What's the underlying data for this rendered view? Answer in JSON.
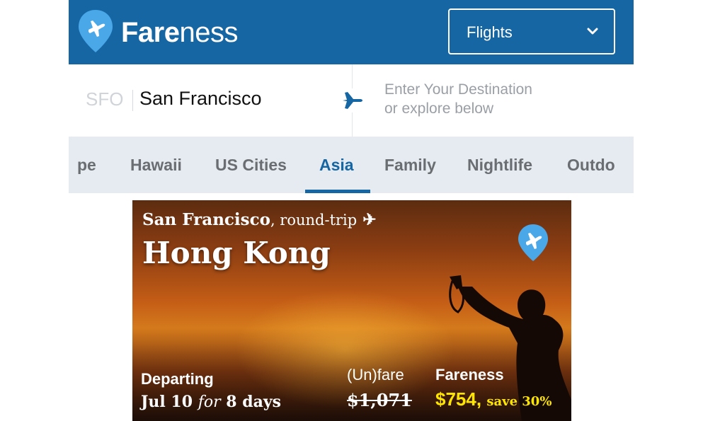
{
  "header": {
    "logo_text_bold": "Fare",
    "logo_text_rest": "ness",
    "mode_select": {
      "label": "Flights",
      "icon": "chevron-down-icon"
    },
    "logo_icon": "plane-pin-icon"
  },
  "search": {
    "origin_code": "SFO",
    "origin_city": "San Francisco",
    "destination_placeholder_line1": "Enter Your Destination",
    "destination_placeholder_line2": "or explore below",
    "separator_icon": "plane-icon"
  },
  "tabs": {
    "items": [
      {
        "label": "pe"
      },
      {
        "label": "Hawaii"
      },
      {
        "label": "US Cities"
      },
      {
        "label": "Asia"
      },
      {
        "label": "Family"
      },
      {
        "label": "Nightlife"
      },
      {
        "label": "Outdo"
      }
    ],
    "active": "Asia"
  },
  "deal": {
    "origin": "San Francisco",
    "trip_type": ", round-trip",
    "trip_icon": "✈",
    "destination": "Hong Kong",
    "departing_label": "Departing",
    "date": "Jul 10",
    "for_text": "for",
    "duration": "8 days",
    "unfare_label": "(Un)fare",
    "unfare_price": "$1,071",
    "fareness_label": "Fareness",
    "fareness_price": "$754,",
    "savings": "save 30%"
  },
  "colors": {
    "brand_blue": "#1566a3",
    "logo_light_blue": "#4aa8e8",
    "tab_bg": "#e5ebf0",
    "price_yellow": "#ffe600"
  }
}
